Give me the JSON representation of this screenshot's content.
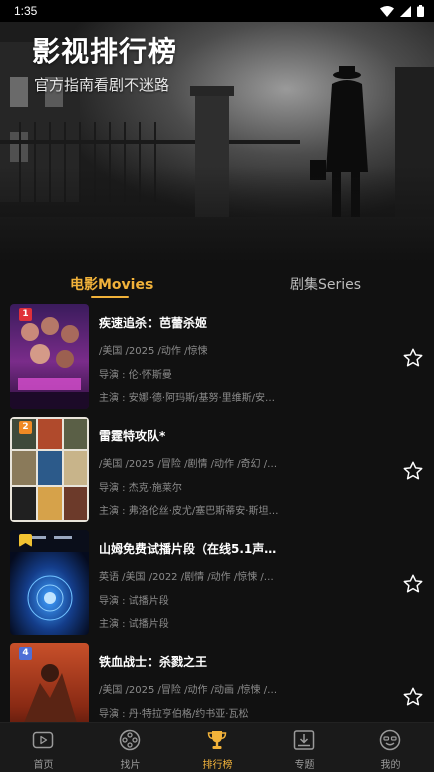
{
  "status_bar": {
    "time": "1:35",
    "icons": [
      "wifi-icon",
      "signal-icon",
      "battery-icon"
    ]
  },
  "hero": {
    "title": "影视排行榜",
    "subtitle": "官方指南看剧不迷路"
  },
  "tabs": [
    {
      "label": "电影Movies",
      "active": true
    },
    {
      "label": "剧集Series",
      "active": false
    }
  ],
  "list": [
    {
      "rank": "1",
      "title": "疾速追杀：芭蕾杀姬",
      "meta": "/美国 /2025 /动作 /惊悚",
      "director": "导演 : 伦·怀斯曼",
      "cast": "主演 : 安娜·德·阿玛斯/基努·里维斯/安杰丽卡·休斯顿",
      "rank_color": "#e0303a",
      "icon": "star-outline-icon"
    },
    {
      "rank": "2",
      "title": "雷霆特攻队*",
      "meta": "/美国 /2025 /冒险 /剧情 /动作 /奇幻 /科幻",
      "director": "导演 : 杰克·施莱尔",
      "cast": "主演 : 弗洛伦丝·皮尤/塞巴斯蒂安·斯坦/大卫·哈伯",
      "rank_color": "#f08a24",
      "icon": "star-outline-icon"
    },
    {
      "rank": "",
      "title": "山姆免费试播片段（在线5.1声道）",
      "meta": "英语 /美国 /2022 /剧情 /动作 /惊悚 /战争",
      "director": "导演 : 试播片段",
      "cast": "主演 : 试播片段",
      "rank_color": "#f1c232",
      "icon": "star-outline-icon"
    },
    {
      "rank": "4",
      "title": "铁血战士：杀戮之王",
      "meta": "/美国 /2025 /冒险 /动作 /动画 /惊悚 /科幻",
      "director": "导演 : 丹·特拉亨伯格/约书亚·瓦松",
      "cast": "",
      "rank_color": "#4f6fd6",
      "icon": "star-outline-icon"
    }
  ],
  "bottom_nav": [
    {
      "label": "首页",
      "icon": "play-icon",
      "active": false
    },
    {
      "label": "找片",
      "icon": "film-reel-icon",
      "active": false
    },
    {
      "label": "排行榜",
      "icon": "trophy-icon",
      "active": true
    },
    {
      "label": "专题",
      "icon": "download-box-icon",
      "active": false
    },
    {
      "label": "我的",
      "icon": "smiley-icon",
      "active": false
    }
  ],
  "colors": {
    "accent": "#f1b23a",
    "background": "#111111",
    "nav_background": "#1a1a1a"
  }
}
